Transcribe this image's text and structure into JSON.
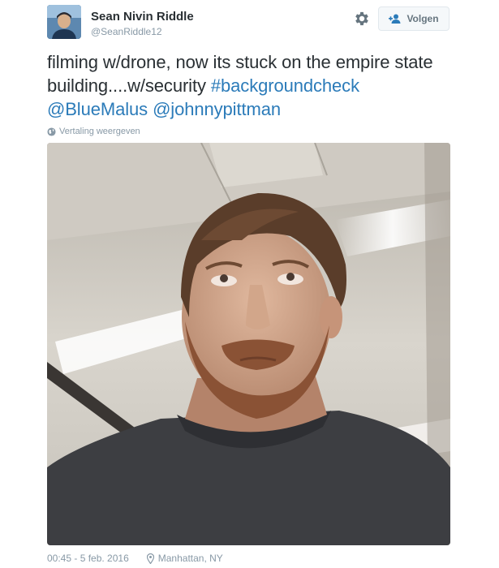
{
  "user": {
    "name": "Sean Nivin Riddle",
    "handle": "@SeanRiddle12"
  },
  "header": {
    "follow_label": "Volgen"
  },
  "tweet": {
    "text_plain": "filming w/drone, now its stuck on the empire state building....w/security ",
    "hashtag": "#backgroundcheck",
    "mention_1": "@BlueMalus",
    "mention_2": "@johnnypittman",
    "translate_label": "Vertaling weergeven",
    "timestamp": "00:45 - 5 feb. 2016",
    "location": "Manhattan, NY"
  },
  "colors": {
    "link": "#2b7bb9",
    "meta": "#8899a6",
    "text": "#292f33"
  },
  "icons": {
    "settings": "gear-icon",
    "follow": "add-user-icon",
    "translate": "globe-icon",
    "location": "map-pin-icon"
  }
}
